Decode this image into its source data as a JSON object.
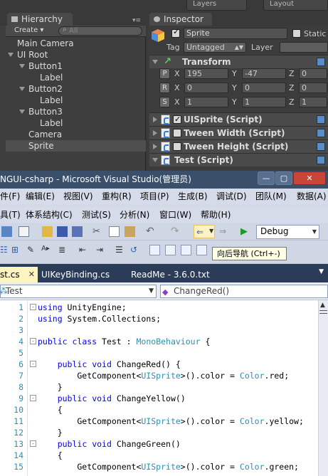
{
  "unity": {
    "top_tabs": [
      "Layers",
      "Layout"
    ],
    "hierarchy": {
      "tab_label": "Hierarchy",
      "create_label": "Create ▾",
      "search_placeholder": "All",
      "items": [
        {
          "label": "Main Camera",
          "indent": 0,
          "expanded": false
        },
        {
          "label": "UI Root",
          "indent": 0,
          "expanded": true
        },
        {
          "label": "Button1",
          "indent": 1,
          "expanded": true
        },
        {
          "label": "Label",
          "indent": 2,
          "expanded": false
        },
        {
          "label": "Button2",
          "indent": 1,
          "expanded": true
        },
        {
          "label": "Label",
          "indent": 2,
          "expanded": false
        },
        {
          "label": "Button3",
          "indent": 1,
          "expanded": true
        },
        {
          "label": "Label",
          "indent": 2,
          "expanded": false
        },
        {
          "label": "Camera",
          "indent": 1,
          "expanded": false
        },
        {
          "label": "Sprite",
          "indent": 1,
          "expanded": false,
          "selected": true
        }
      ]
    },
    "inspector": {
      "tab_label": "Inspector",
      "object_name": "Sprite",
      "static_label": "Static",
      "tag_label": "Tag",
      "tag_value": "Untagged",
      "layer_label": "Layer",
      "transform": {
        "title": "Transform",
        "rows": [
          {
            "btn": "P",
            "x": "195",
            "y": "-47",
            "z": "0"
          },
          {
            "btn": "R",
            "x": "0",
            "y": "0",
            "z": "0"
          },
          {
            "btn": "S",
            "x": "1",
            "y": "1",
            "z": "1"
          }
        ],
        "axis_x": "X",
        "axis_y": "Y",
        "axis_z": "Z"
      },
      "components": [
        {
          "label": "UISprite (Script)",
          "checked": true
        },
        {
          "label": "Tween Width (Script)",
          "checked": false
        },
        {
          "label": "Tween Height (Script)",
          "checked": false
        },
        {
          "label": "Test (Script)",
          "checked": null
        }
      ]
    }
  },
  "vs": {
    "window_title": "NGUI-csharp - Microsoft Visual Studio(管理员)",
    "window_buttons": [
      "—",
      "▢",
      "✕"
    ],
    "menu_row1": [
      "件(F)",
      "编辑(E)",
      "视图(V)",
      "重构(R)",
      "项目(P)",
      "生成(B)",
      "调试(D)",
      "团队(M)",
      "数据(A)"
    ],
    "menu_row2": [
      "具(T)",
      "体系结构(C)",
      "测试(S)",
      "分析(N)",
      "窗口(W)",
      "帮助(H)"
    ],
    "config_value": "Debug",
    "tooltip": "向后导航 (Ctrl+-)",
    "doc_tabs": [
      {
        "label": "st.cs",
        "active": true
      },
      {
        "label": "UIKeyBinding.cs",
        "active": false
      },
      {
        "label": "ReadMe - 3.6.0.txt",
        "active": false
      }
    ],
    "nav_left": "Test",
    "nav_right": "ChangeRed()",
    "code": [
      {
        "n": "1",
        "text": "using UnityEngine;",
        "fold": "-"
      },
      {
        "n": "2",
        "text": "using System.Collections;",
        "fold": ""
      },
      {
        "n": "3",
        "text": "",
        "fold": ""
      },
      {
        "n": "4",
        "text": "public class Test : MonoBehaviour {",
        "fold": "-"
      },
      {
        "n": "5",
        "text": "",
        "fold": ""
      },
      {
        "n": "6",
        "text": "    public void ChangeRed() {",
        "fold": "-"
      },
      {
        "n": "7",
        "text": "        GetComponent<UISprite>().color = Color.red;",
        "fold": ""
      },
      {
        "n": "8",
        "text": "    }",
        "fold": ""
      },
      {
        "n": "9",
        "text": "    public void ChangeYellow()",
        "fold": "-"
      },
      {
        "n": "10",
        "text": "    {",
        "fold": ""
      },
      {
        "n": "11",
        "text": "        GetComponent<UISprite>().color = Color.yellow;",
        "fold": ""
      },
      {
        "n": "12",
        "text": "    }",
        "fold": ""
      },
      {
        "n": "13",
        "text": "    public void ChangeGreen()",
        "fold": "-"
      },
      {
        "n": "14",
        "text": "    {",
        "fold": ""
      },
      {
        "n": "15",
        "text": "        GetComponent<UISprite>().color = Color.green;",
        "fold": ""
      }
    ]
  }
}
